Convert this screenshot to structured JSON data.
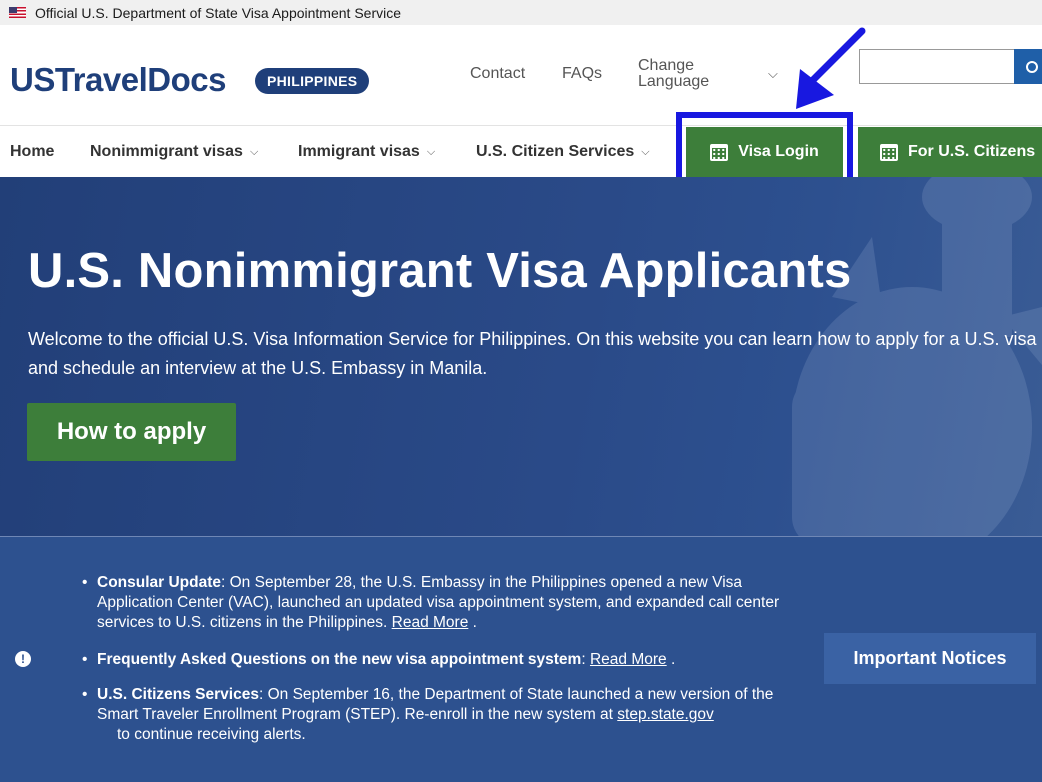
{
  "gov_banner": {
    "text": "Official U.S. Department of State Visa Appointment Service",
    "flag_icon": "us-flag-icon"
  },
  "header": {
    "logo": "USTravelDocs",
    "country": "PHILIPPINES",
    "links": {
      "contact": "Contact",
      "faqs": "FAQs",
      "change_language_line1": "Change",
      "change_language_line2": "Language"
    },
    "search": {
      "placeholder": "",
      "icon": "search-icon"
    }
  },
  "nav": {
    "items": [
      {
        "label": "Home"
      },
      {
        "label": "Nonimmigrant visas"
      },
      {
        "label": "Immigrant visas"
      },
      {
        "label": "U.S. Citizen Services"
      }
    ],
    "visa_login": "Visa Login",
    "us_citizens": "For U.S. Citizens"
  },
  "hero": {
    "title": "U.S. Nonimmigrant Visa Applicants",
    "text": "Welcome to the official U.S. Visa Information Service for Philippines. On this website you can learn how to apply for a U.S. visa and schedule an interview at the U.S. Embassy in Manila.",
    "button": "How to apply"
  },
  "notices": {
    "items": [
      {
        "title": "Consular Update",
        "text": ": On September 28, the U.S. Embassy in the Philippines opened a new Visa Application Center (VAC), launched an updated visa appointment system, and expanded call center services to U.S. citizens in the Philippines. ",
        "link": "Read More",
        "tail": " ."
      },
      {
        "title": "Frequently Asked Questions on the new visa appointment system",
        "text": ": ",
        "link": "Read More",
        "tail": " ."
      },
      {
        "title": "U.S. Citizens Services",
        "text": ": On September 16, the Department of State launched a new version of the Smart Traveler Enrollment Program (STEP). Re-enroll in the new system at ",
        "link": "step.state.gov",
        "tail": "to continue receiving alerts."
      }
    ],
    "button": "Important Notices"
  },
  "colors": {
    "brand_blue": "#1f3f7a",
    "green": "#3d7e3a",
    "highlight": "#1818e0",
    "hero_bg": "#2a4a88"
  }
}
